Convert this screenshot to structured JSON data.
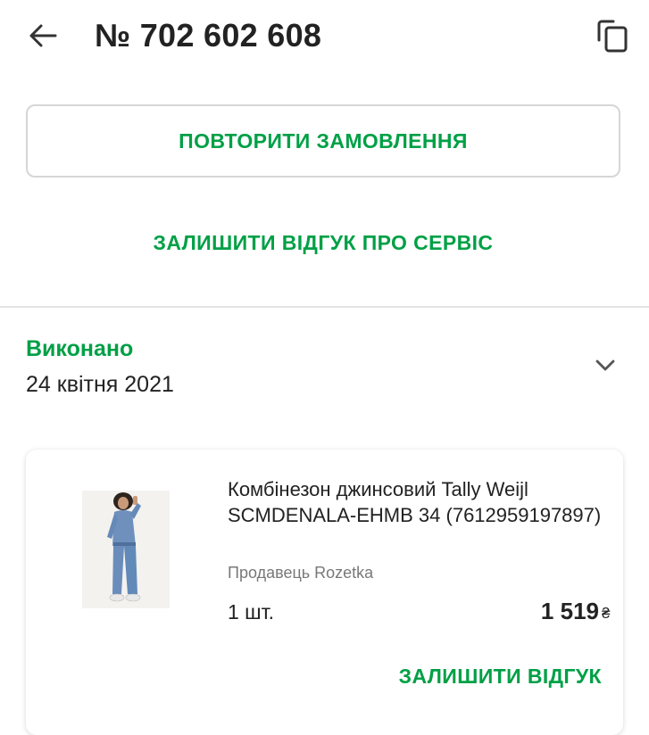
{
  "header": {
    "order_number": "№ 702 602 608"
  },
  "actions": {
    "repeat_order": "ПОВТОРИТИ ЗАМОВЛЕННЯ",
    "service_review": "ЗАЛИШИТИ ВІДГУК ПРО СЕРВІС"
  },
  "status": {
    "label": "Виконано",
    "date": "24 квітня 2021"
  },
  "product": {
    "name": "Комбінезон джинсовий Tally Weijl SCMDENALA-EHMB 34 (7612959197897)",
    "seller": "Продавець Rozetka",
    "quantity": "1 шт.",
    "price": "1 519",
    "currency": "₴",
    "review_button": "ЗАЛИШИТИ ВІДГУК"
  },
  "colors": {
    "accent": "#00a046",
    "text": "#222222",
    "muted": "#797878",
    "border": "#d6d6d6"
  }
}
